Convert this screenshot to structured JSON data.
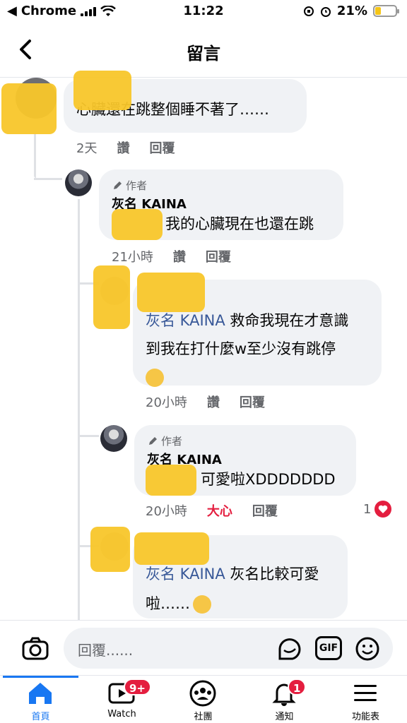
{
  "status_bar": {
    "carrier": "Chrome",
    "time": "11:22",
    "battery": "21%"
  },
  "header": {
    "title": "留言"
  },
  "comments": [
    {
      "text": "心臟還在跳整個睡不著了……",
      "time": "2天",
      "like": "讚",
      "reply": "回覆"
    },
    {
      "author_tag": "作者",
      "author": "灰名 KAINA",
      "text": "我的心臟現在也還在跳",
      "time": "21小時",
      "like": "讚",
      "reply": "回覆"
    },
    {
      "mention": "灰名 KAINA",
      "text_line1": " 救命我現在才意識",
      "text_line2": "到我在打什麼w至少沒有跳停",
      "time": "20小時",
      "like": "讚",
      "reply": "回覆"
    },
    {
      "author_tag": "作者",
      "author": "灰名 KAINA",
      "text": "可愛啦XDDDDDDD",
      "time": "20小時",
      "reaction": "大心",
      "reply": "回覆",
      "reaction_count": "1"
    },
    {
      "mention": "灰名 KAINA",
      "text_line1": " 灰名比較可愛",
      "text_line2": "啦……"
    }
  ],
  "composer": {
    "placeholder": "回覆......",
    "gif_label": "GIF"
  },
  "tabs": [
    {
      "label": "首頁",
      "icon": "home-icon"
    },
    {
      "label": "Watch",
      "icon": "watch-icon",
      "badge": "9+"
    },
    {
      "label": "社團",
      "icon": "groups-icon"
    },
    {
      "label": "通知",
      "icon": "bell-icon",
      "badge": "1"
    },
    {
      "label": "功能表",
      "icon": "menu-icon"
    }
  ],
  "colors": {
    "accent": "#1877f2",
    "love": "#e41e3f",
    "bubble": "#f0f2f5",
    "mention": "#385898"
  }
}
